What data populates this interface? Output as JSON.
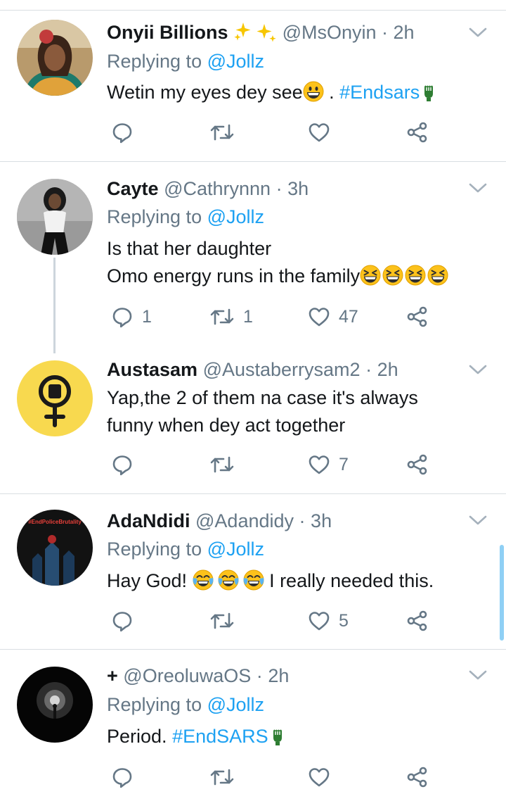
{
  "colors": {
    "link": "#1da1f2",
    "muted": "#657786",
    "text": "#14171a",
    "divider": "#d9dee2"
  },
  "tweets": [
    {
      "name": "Onyii Billions",
      "name_decoration": "sparkles-icon",
      "handle": "@MsOnyin",
      "sep": "·",
      "time": "2h",
      "replying_prefix": "Replying to ",
      "replying_to": "@Jollz",
      "body": "Wetin my eyes dey see",
      "body_suffix": " . ",
      "hashtag": "#Endsars",
      "counts": {
        "reply": "",
        "retweet": "",
        "like": ""
      }
    },
    {
      "name": "Cayte",
      "handle": "@Cathrynnn",
      "sep": "·",
      "time": "3h",
      "replying_prefix": "Replying to ",
      "replying_to": "@Jollz",
      "body_line1": "Is that her daughter",
      "body_line2": "Omo energy runs in the family",
      "counts": {
        "reply": "1",
        "retweet": "1",
        "like": "47"
      }
    },
    {
      "name": "Austasam",
      "handle": "@Austaberrysam2",
      "sep": "·",
      "time": "2h",
      "body_line1": "Yap,the 2 of them na case it's always",
      "body_line2": "funny when dey act together",
      "counts": {
        "reply": "",
        "retweet": "",
        "like": "7"
      }
    },
    {
      "name": "AdaNdidi",
      "handle": "@Adandidy",
      "sep": "·",
      "time": "3h",
      "avatar_text": "#EndPoliceBrutality",
      "replying_prefix": "Replying to ",
      "replying_to": "@Jollz",
      "body_before": "Hay God! ",
      "body_after": " I really needed this.",
      "counts": {
        "reply": "",
        "retweet": "",
        "like": "5"
      }
    },
    {
      "name": "+",
      "handle": "@OreoluwaOS",
      "sep": "·",
      "time": "2h",
      "replying_prefix": "Replying to ",
      "replying_to": "@Jollz",
      "body": "Period. ",
      "hashtag": "#EndSARS",
      "counts": {
        "reply": "",
        "retweet": "",
        "like": ""
      }
    }
  ]
}
